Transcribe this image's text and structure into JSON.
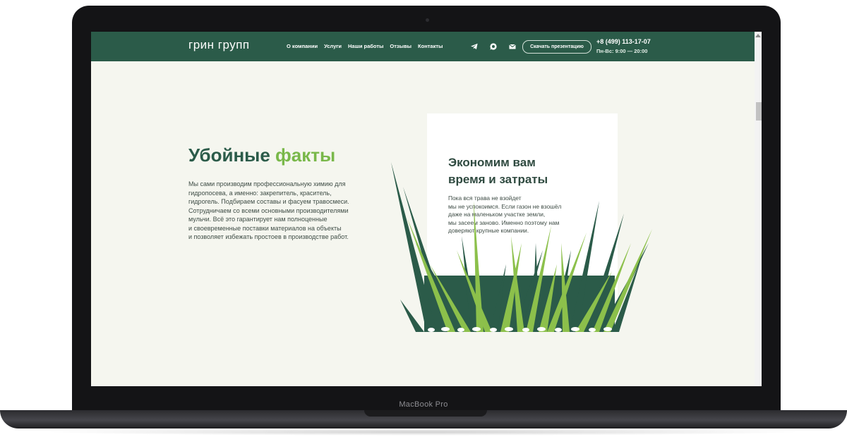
{
  "device": {
    "brand_label": "MacBook Pro"
  },
  "header": {
    "logo": "грин групп",
    "menu": [
      "О компании",
      "Услуги",
      "Наши работы",
      "Отзывы",
      "Контакты"
    ],
    "icons": [
      "telegram-icon",
      "whatsapp-icon",
      "mail-icon"
    ],
    "presentation_button": "Скачать презентацию",
    "phone": "+8 (499) 113-17-07",
    "hours": "Пн-Вс: 9:00 — 20:00"
  },
  "facts": {
    "title_main": "Убойные ",
    "title_accent": "факты",
    "lines": [
      "Мы сами производим профессиональную химию для",
      "гидропосева, а именно: закрепитель, краситель,",
      "гидрогель. Подбираем составы и фасуем травосмеси.",
      "Сотрудничаем со всеми основными производителями",
      "мульчи. Всё это гарантирует нам полноценные",
      "и своевременные поставки материалов на объекты",
      "и позволяет избежать простоев в производстве работ."
    ]
  },
  "card": {
    "title_lines": [
      "Экономим вам",
      "время и затраты"
    ],
    "text_lines": [
      "Пока вся трава не взойдет",
      "мы не успокоимся. Если газон не взошёл",
      "даже на маленьком участке земли,",
      "мы засеем заново. Именно поэтому нам",
      "доверяют крупные компании."
    ]
  },
  "colors": {
    "primary": "#2b5b49",
    "accent": "#79b84a",
    "background": "#f5f6ef",
    "grass_dark": "#2b5b49",
    "grass_light": "#8cc04b"
  }
}
